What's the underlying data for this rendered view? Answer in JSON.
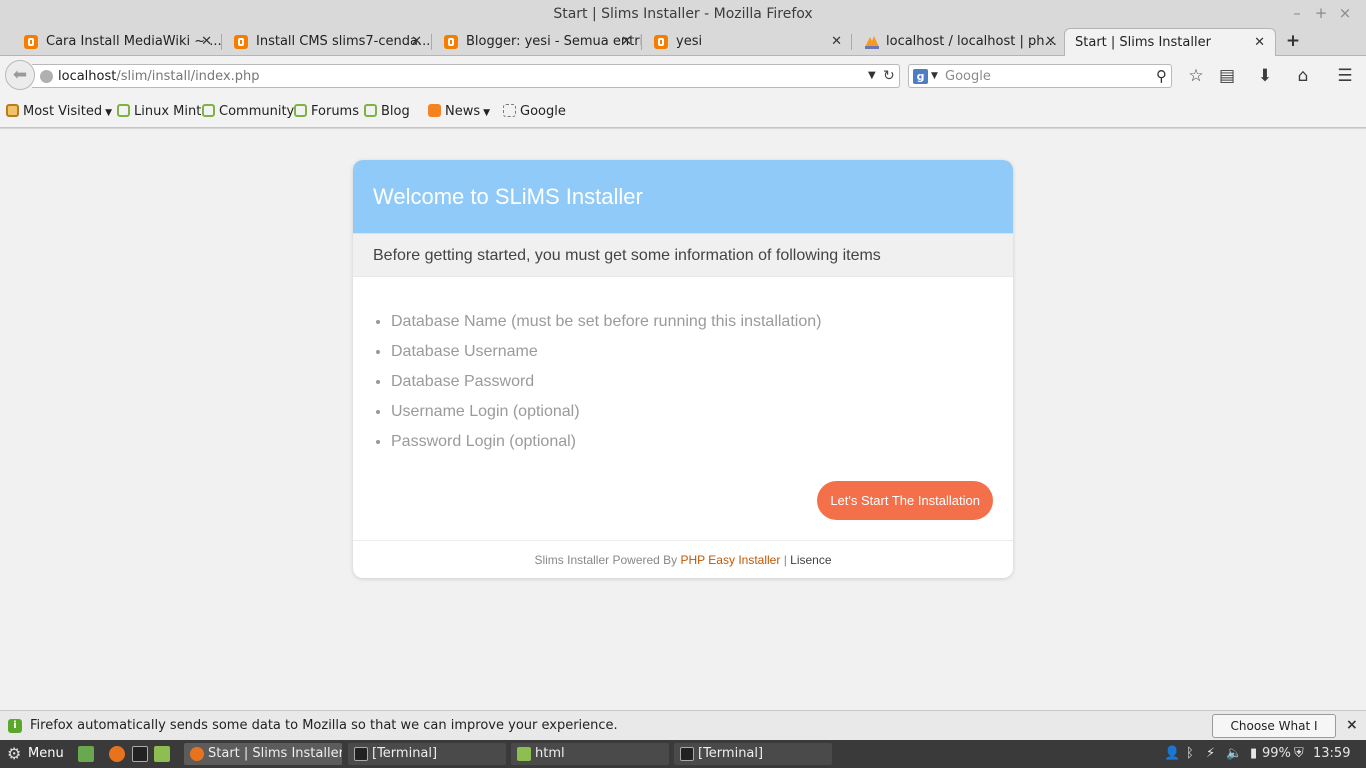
{
  "window": {
    "title": "Start | Slims Installer - Mozilla Firefox",
    "controls": {
      "minimize": "–",
      "maximize": "+",
      "close": "×"
    }
  },
  "tabs": [
    {
      "label": "Cara Install MediaWiki ~ ...",
      "icon": "blogger-icon"
    },
    {
      "label": "Install CMS slims7-cenda...",
      "icon": "blogger-icon"
    },
    {
      "label": "Blogger: yesi - Semua entri",
      "icon": "blogger-icon"
    },
    {
      "label": "yesi",
      "icon": "blogger-icon"
    },
    {
      "label": "localhost / localhost | ph...",
      "icon": "phpmyadmin-icon"
    },
    {
      "label": "Start | Slims Installer",
      "active": true
    }
  ],
  "navbar": {
    "url_host": "localhost",
    "url_path": "/slim/install/index.php",
    "search_placeholder": "Google",
    "search_engine_glyph": "g"
  },
  "bookmarks": [
    {
      "label": "Most Visited",
      "icon": "folder-icon",
      "dropdown": true
    },
    {
      "label": "Linux Mint",
      "icon": "mint-icon"
    },
    {
      "label": "Community",
      "icon": "mint-icon"
    },
    {
      "label": "Forums",
      "icon": "mint-icon"
    },
    {
      "label": "Blog",
      "icon": "mint-icon"
    },
    {
      "label": "News",
      "icon": "rss-icon",
      "dropdown": true
    },
    {
      "label": "Google",
      "icon": "page-icon"
    }
  ],
  "installer": {
    "title": "Welcome to SLiMS Installer",
    "subtitle": "Before getting started, you must get some information of following items",
    "items": [
      "Database Name (must be set before running this installation)",
      "Database Username",
      "Database Password",
      "Username Login (optional)",
      "Password Login (optional)"
    ],
    "start_button": "Let's Start The Installation",
    "footer": {
      "powered_by": "Slims Installer Powered By",
      "link": "PHP Easy Installer",
      "separator": "|",
      "licence": "Lisence"
    }
  },
  "notification": {
    "message": "Firefox automatically sends some data to Mozilla so that we can improve your experience.",
    "button": "Choose What I Share",
    "close": "×"
  },
  "taskbar": {
    "menu_label": "Menu",
    "tasks": [
      {
        "label": "Start | Slims Installer...",
        "icon": "firefox-icon",
        "active": true
      },
      {
        "label": "[Terminal]",
        "icon": "terminal-icon"
      },
      {
        "label": "html",
        "icon": "folder-icon"
      },
      {
        "label": "[Terminal]",
        "icon": "terminal-icon"
      }
    ],
    "battery": "99%",
    "clock": "13:59"
  },
  "colors": {
    "header_blue": "#90caf9",
    "button_orange": "#f4704a",
    "link_orange": "#c25700",
    "blogger_orange": "#f57d00"
  }
}
